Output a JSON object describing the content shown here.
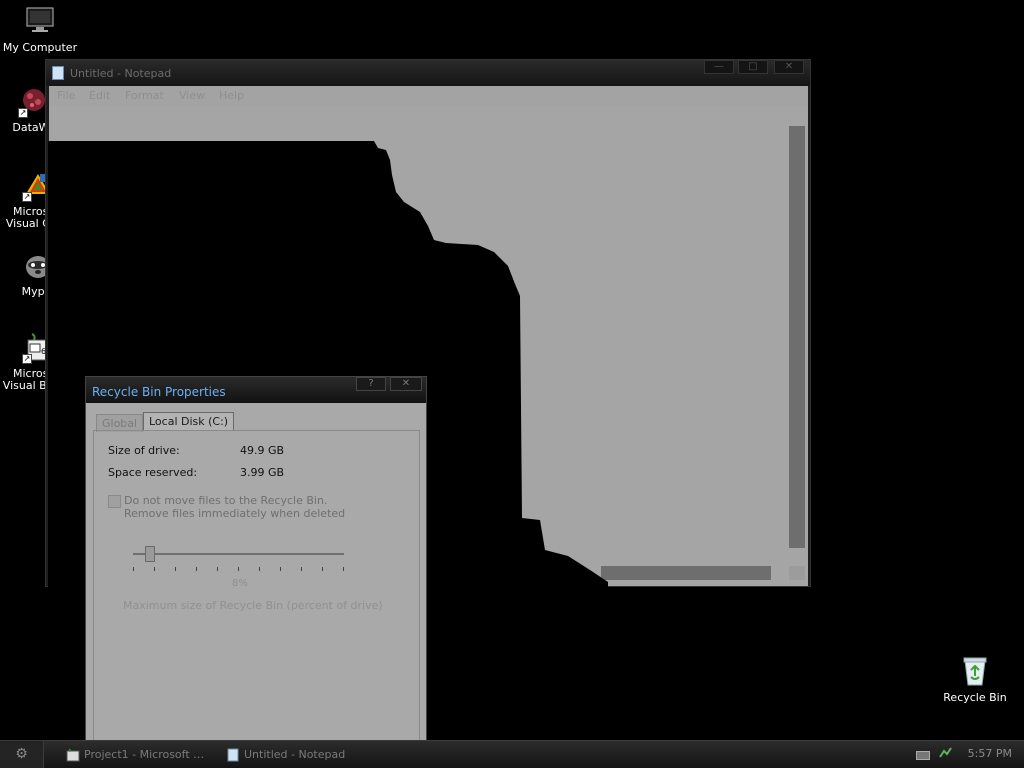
{
  "desktop": {
    "icons": [
      {
        "label": "My Computer",
        "icon": "monitor-icon"
      },
      {
        "label": "DataWa",
        "icon": "datawarrior-icon"
      },
      {
        "label": "Microsoft Visual C+…",
        "icon": "visual-cpp-icon"
      },
      {
        "label": "Mypal",
        "icon": "mypal-icon"
      },
      {
        "label": "Microsoft Visual Basi…",
        "icon": "visual-basic-icon"
      }
    ],
    "recycle_bin": {
      "label": "Recycle Bin",
      "icon": "recycle-bin-icon"
    }
  },
  "notepad": {
    "title": "Untitled - Notepad",
    "menu": [
      "File",
      "Edit",
      "Format",
      "View",
      "Help"
    ],
    "buttons": {
      "minimize": "—",
      "maximize": "□",
      "close": "✕"
    }
  },
  "dialog": {
    "title": "Recycle Bin Properties",
    "help": "?",
    "close": "✕",
    "tabs": [
      "Global",
      "Local Disk (C:)"
    ],
    "active_tab": "Local Disk (C:)",
    "size_label": "Size of drive:",
    "size_value": "49.9 GB",
    "reserved_label": "Space reserved:",
    "reserved_value": "3.99 GB",
    "checkbox_line1": "Do not move files to the Recycle Bin.",
    "checkbox_line2": "Remove files immediately when deleted",
    "slider_percent_label": "8%",
    "slider_value_percent": 8,
    "max_size_label": "Maximum size of Recycle Bin (percent of drive)"
  },
  "taskbar": {
    "start_icon": "start-gear-icon",
    "tasks": [
      {
        "label": "Project1 - Microsoft …",
        "icon": "visual-basic-icon"
      },
      {
        "label": "Untitled - Notepad",
        "icon": "notepad-icon"
      }
    ],
    "clock": "5:57 PM"
  }
}
